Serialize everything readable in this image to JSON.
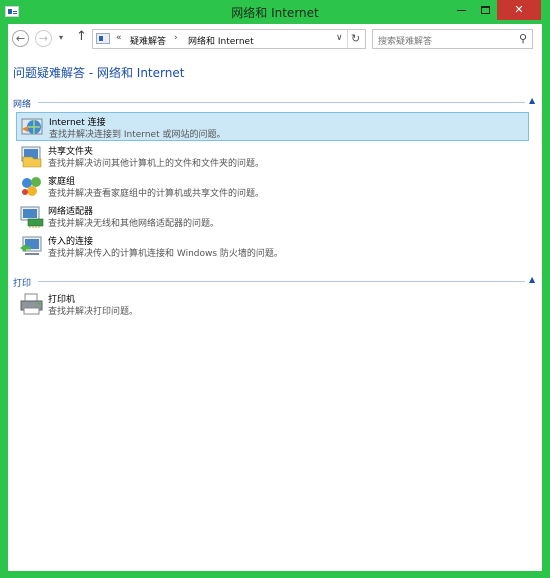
{
  "window": {
    "title": "网络和 Internet",
    "app_icon": "control-panel-icon",
    "minimize_glyph": "—",
    "close_glyph": "✕"
  },
  "nav": {
    "back_glyph": "←",
    "forward_glyph": "→",
    "recent_glyph": "▾",
    "up_glyph": "↑",
    "address": {
      "overflow": "«",
      "crumbs": [
        "疑难解答",
        "网络和 Internet"
      ],
      "separator": "›",
      "dropdown_glyph": "∨",
      "refresh_glyph": "↻"
    },
    "search": {
      "placeholder": "搜索疑难解答",
      "icon_glyph": "⚲"
    }
  },
  "main": {
    "page_title": "问题疑难解答 - 网络和 Internet",
    "sections": [
      {
        "label": "网络",
        "caret": "▲",
        "items": [
          {
            "title": "Internet 连接",
            "desc": "查找并解决连接到 Internet 或网站的问题。",
            "icon": "internet-connections-icon",
            "selected": true
          },
          {
            "title": "共享文件夹",
            "desc": "查找并解决访问其他计算机上的文件和文件夹的问题。",
            "icon": "shared-folders-icon",
            "selected": false
          },
          {
            "title": "家庭组",
            "desc": "查找并解决查看家庭组中的计算机或共享文件的问题。",
            "icon": "homegroup-icon",
            "selected": false
          },
          {
            "title": "网络适配器",
            "desc": "查找并解决无线和其他网络适配器的问题。",
            "icon": "network-adapter-icon",
            "selected": false
          },
          {
            "title": "传入的连接",
            "desc": "查找并解决传入的计算机连接和 Windows 防火墙的问题。",
            "icon": "incoming-connections-icon",
            "selected": false
          }
        ]
      },
      {
        "label": "打印",
        "caret": "▲",
        "items": [
          {
            "title": "打印机",
            "desc": "查找并解决打印问题。",
            "icon": "printer-icon",
            "selected": false
          }
        ]
      }
    ]
  },
  "colors": {
    "window_frame": "#2cc44b",
    "accent_text": "#1a4ea8",
    "selection_bg": "#cce8f7",
    "close_button": "#c7372f"
  }
}
